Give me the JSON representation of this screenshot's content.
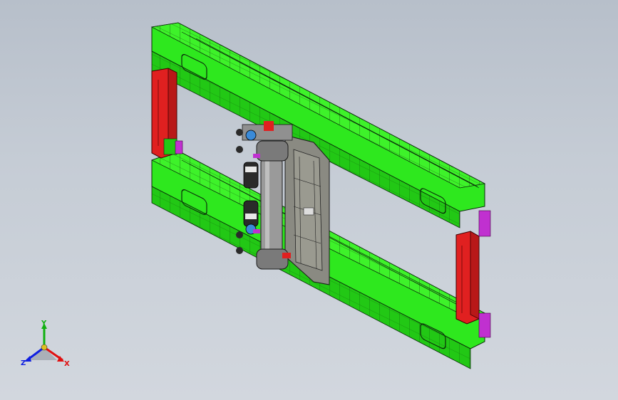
{
  "viewport": {
    "background_top": "#b7bfca",
    "background_bottom": "#d2d7de"
  },
  "model": {
    "frame_color": "#2ee81e",
    "frame_shade": "#22c815",
    "upright_color": "#e02020",
    "carriage_color": "#8a8a82",
    "bracket_color": "#c030d0",
    "cylinder_color": "#9a9a9a",
    "edge_color": "#0a2a0a"
  },
  "triad": {
    "x_label": "X",
    "y_label": "Y",
    "z_label": "Z",
    "x_color": "#e01010",
    "y_color": "#10b010",
    "z_color": "#1020e0"
  }
}
